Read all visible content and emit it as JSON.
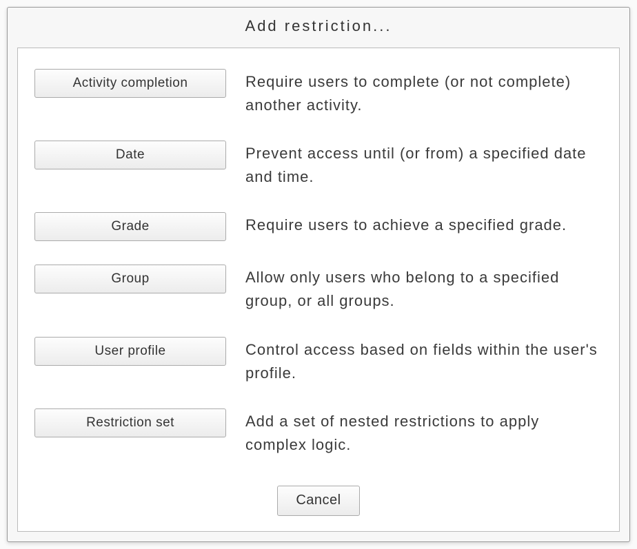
{
  "dialog": {
    "title": "Add restriction...",
    "options": [
      {
        "label": "Activity completion",
        "description": "Require users to complete (or not complete) another activity."
      },
      {
        "label": "Date",
        "description": "Prevent access until (or from) a specified date and time."
      },
      {
        "label": "Grade",
        "description": "Require users to achieve a specified grade."
      },
      {
        "label": "Group",
        "description": "Allow only users who belong to a specified group, or all groups."
      },
      {
        "label": "User profile",
        "description": "Control access based on fields within the user's profile."
      },
      {
        "label": "Restriction set",
        "description": "Add a set of nested restrictions to apply complex logic."
      }
    ],
    "cancel_label": "Cancel"
  }
}
